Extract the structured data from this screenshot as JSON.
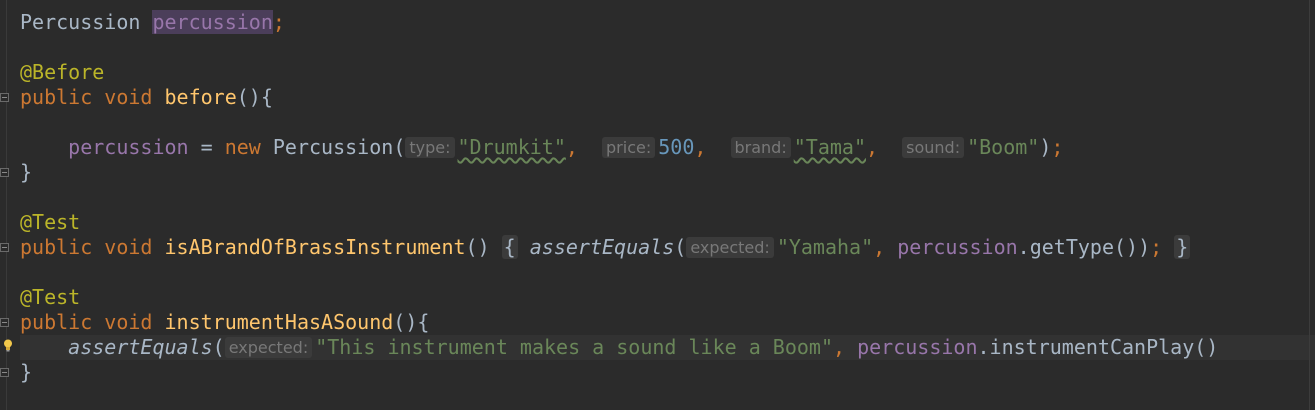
{
  "editor": {
    "field_type": "Percussion",
    "field_name": "percussion",
    "annotation_before": "@Before",
    "annotation_test": "@Test",
    "kw_public": "public",
    "kw_void": "void",
    "kw_new": "new",
    "before_method": "before",
    "percussion_class": "Percussion",
    "hint_type": "type:",
    "val_type": "\"Drumkit\"",
    "hint_price": "price:",
    "val_price": "500",
    "hint_brand": "brand:",
    "val_brand": "\"Tama\"",
    "hint_sound": "sound:",
    "val_sound": "\"Boom\"",
    "test1_method": "isABrandOfBrassInstrument",
    "assert_equals": "assertEquals",
    "hint_expected": "expected:",
    "expected_yamaha": "\"Yamaha\"",
    "get_type_call": "getType",
    "test2_method": "instrumentHasASound",
    "expected_sound": "\"This instrument makes a sound like a Boom\"",
    "instrument_can_play": "instrumentCanPlay"
  },
  "colors": {
    "background": "#2b2b2b",
    "keyword": "#cc7832",
    "annotation": "#bbb529",
    "method": "#ffc66d",
    "string": "#6a8759",
    "number": "#6897bb",
    "field": "#9876aa",
    "default_text": "#a9b7c6"
  }
}
